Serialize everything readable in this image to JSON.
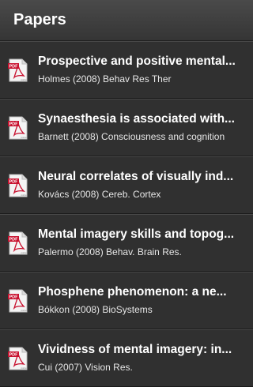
{
  "header": {
    "title": "Papers"
  },
  "icon": {
    "name": "pdf-icon",
    "label": "PDF",
    "brand": "Adobe",
    "color": "#c8102e"
  },
  "papers": [
    {
      "title": "Prospective and positive mental...",
      "subtitle": "Holmes (2008) Behav Res Ther"
    },
    {
      "title": "Synaesthesia is associated with...",
      "subtitle": "Barnett (2008) Consciousness and cognition"
    },
    {
      "title": "Neural correlates of visually ind...",
      "subtitle": "Kovács (2008) Cereb. Cortex"
    },
    {
      "title": "Mental imagery skills and topog...",
      "subtitle": "Palermo (2008) Behav. Brain Res."
    },
    {
      "title": "Phosphene phenomenon: a ne...",
      "subtitle": "Bókkon (2008) BioSystems"
    },
    {
      "title": "Vividness of mental imagery: in...",
      "subtitle": "Cui (2007) Vision Res."
    }
  ]
}
